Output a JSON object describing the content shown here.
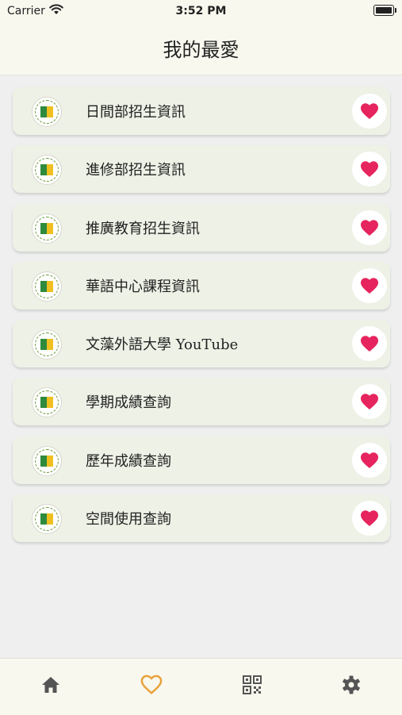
{
  "status_bar": {
    "carrier": "Carrier",
    "time": "3:52 PM"
  },
  "header": {
    "title": "我的最愛"
  },
  "favorites": [
    {
      "label": "日間部招生資訊",
      "favorited": true
    },
    {
      "label": "進修部招生資訊",
      "favorited": true
    },
    {
      "label": "推廣教育招生資訊",
      "favorited": true
    },
    {
      "label": "華語中心課程資訊",
      "favorited": true
    },
    {
      "label": "文藻外語大學 YouTube",
      "favorited": true
    },
    {
      "label": "學期成績查詢",
      "favorited": true
    },
    {
      "label": "歷年成績查詢",
      "favorited": true
    },
    {
      "label": "空間使用查詢",
      "favorited": true
    }
  ],
  "tab_bar": {
    "tabs": [
      {
        "icon": "home-icon",
        "active": false
      },
      {
        "icon": "heart-outline-icon",
        "active": true
      },
      {
        "icon": "qr-code-icon",
        "active": false
      },
      {
        "icon": "gear-icon",
        "active": false
      }
    ]
  },
  "colors": {
    "heart": "#e6245e",
    "active_tab": "#e9a23b",
    "inactive_tab": "#555555",
    "card_bg": "#eef1e6",
    "bar_bg": "#f8f8ef"
  }
}
